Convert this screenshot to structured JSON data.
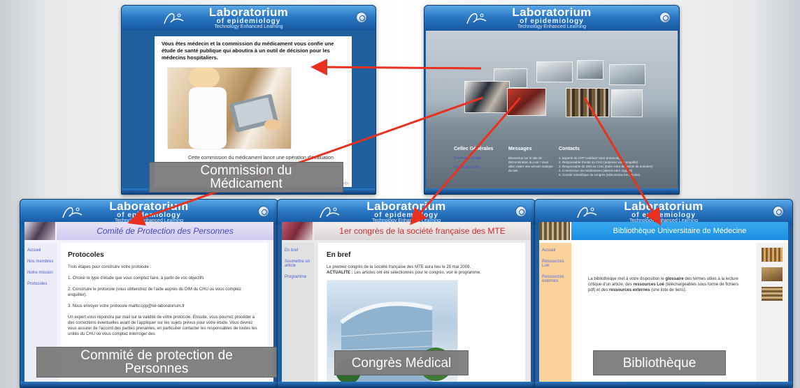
{
  "brand": {
    "title": "Laboratorium",
    "subtitle": "of epidemiology",
    "tagline": "Technology Enhanced Learning"
  },
  "commission": {
    "intro": "Vous êtes médecin et la commission du médicament vous confie une étude de santé publique qui aboutira à un outil de décision pour les médecins hospitaliers.",
    "body": "Cette commission du médicament lance une opération d'évaluation",
    "caption_line1": "Commission du",
    "caption_line2": "Médicament",
    "footer_icon": "▷▷▷"
  },
  "hub": {
    "col1_title": "Cellec Générales",
    "col1_links": [
      "Sommaire du site",
      "Ressources Loé"
    ],
    "col2_title": "Messages",
    "col2_text": "Bienvenue sur le site de démonstration du Loé ! Vous allez visiter une version statique du site.",
    "col3_title": "Contacts",
    "col3_items": [
      "1. Experts du CPP (validant votre protocole)",
      "2. Responsable d'unité au CHU (autoriser votre enquête)",
      "3. Responsable du DIM au CHU (traite votre demande de données)",
      "4. Commission du médicament (attend votre rapport)",
      "5. Comité scientifique du congrès (sélectionne les articles)"
    ]
  },
  "cpp": {
    "header": "Comité de Protection des Personnes",
    "nav": [
      "Accueil",
      "Nos membres",
      "Notre mission",
      "Protocoles"
    ],
    "heading": "Protocoles",
    "p1": "Trois étapes pour construire votre protocole :",
    "p2": "1. Choisir le type d'étude que vous comptez faire, à partir de vos objectifs",
    "p3": "2. Construire le protocole (vous obtiendrez de l'aide auprès du DIM du CHU où vous comptez enquêter).",
    "p4": "3. Nous envoyer votre protocole mailto:cpp@tel-laboratorium.fr",
    "p5": "Un expert vous répondra par mail sur la validité de votre protocole. Ensuite, vous pourrez procéder à des corrections éventuelles avant de l'appliquer sur les sujets prévus pour votre étude. Vous devrez vous assurer de l'accord des parties prenantes, en particulier contacter les responsables de toutes les unités du CHU où vous comptez interroger des",
    "caption_line1": "Commité de protection de",
    "caption_line2": "Personnes"
  },
  "congres": {
    "header": "1er congrès de la société française des MTE",
    "nav": [
      "En bref",
      "Soumettre un article",
      "Programme"
    ],
    "heading": "En bref",
    "p1": "Le premier congrès de la société française des MTE aura lieu le 25 mai 2009.",
    "p2_label": "ACTUALITE :",
    "p2": " Les articles ont été sélectionnés pour le congrès, voir le programme.",
    "caption": "Congrès Médical"
  },
  "biblio": {
    "header": "Bibliothèque Universitaire de Médecine",
    "nav": [
      "Accueil",
      "Ressources Loé",
      "Ressources externes"
    ],
    "t1": "La bibliothèque met à votre disposition le ",
    "t2": "glossaire",
    "t3": " des termes utiles à la lecture critique d'un article, des ",
    "t4": "ressources Loé",
    "t5": " (téléchargeables sous forme de fichiers pdf) et des ",
    "t6": "ressources externes",
    "t7": " (une liste de liens).",
    "caption": "Bibliothèque"
  },
  "colors": {
    "arrow": "#e8321f",
    "window_frame": "#1f5fa0",
    "caption_bg": "#7d7d7d"
  }
}
